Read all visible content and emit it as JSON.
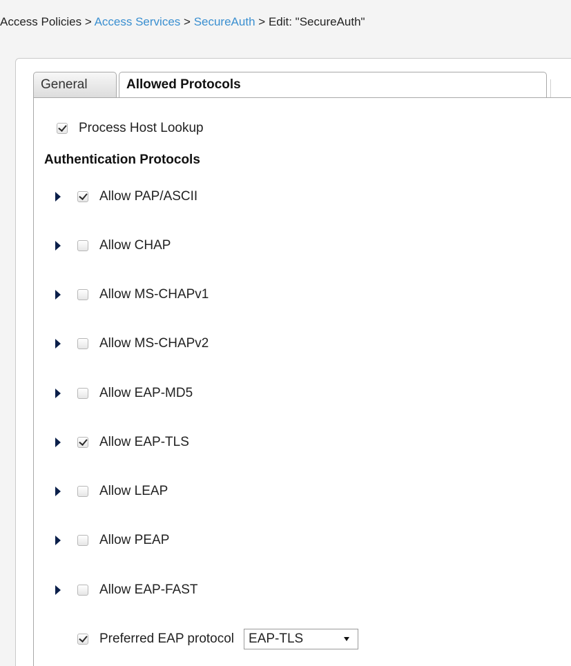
{
  "breadcrumb": {
    "root": "Access Policies",
    "separator": ">",
    "level1": "Access Services",
    "level2": "SecureAuth",
    "current": "Edit: \"SecureAuth\""
  },
  "tabs": [
    {
      "label": "General",
      "active": false
    },
    {
      "label": "Allowed Protocols",
      "active": true
    }
  ],
  "process_host_lookup": {
    "label": "Process Host Lookup",
    "checked": true
  },
  "section_heading": "Authentication Protocols",
  "protocols": [
    {
      "label": "Allow PAP/ASCII",
      "checked": true
    },
    {
      "label": "Allow CHAP",
      "checked": false
    },
    {
      "label": "Allow MS-CHAPv1",
      "checked": false
    },
    {
      "label": "Allow MS-CHAPv2",
      "checked": false
    },
    {
      "label": "Allow EAP-MD5",
      "checked": false
    },
    {
      "label": "Allow EAP-TLS",
      "checked": true
    },
    {
      "label": "Allow LEAP",
      "checked": false
    },
    {
      "label": "Allow PEAP",
      "checked": false
    },
    {
      "label": "Allow EAP-FAST",
      "checked": false
    }
  ],
  "preferred_eap": {
    "label": "Preferred EAP protocol",
    "checked": true,
    "selected_value": "EAP-TLS"
  },
  "icons": {
    "expand": "expand-arrow-icon",
    "checkbox": "checkbox-icon",
    "dropdown": "dropdown-caret-icon"
  },
  "colors": {
    "link": "#3a8fd0",
    "arrow": "#0b1f4a"
  }
}
